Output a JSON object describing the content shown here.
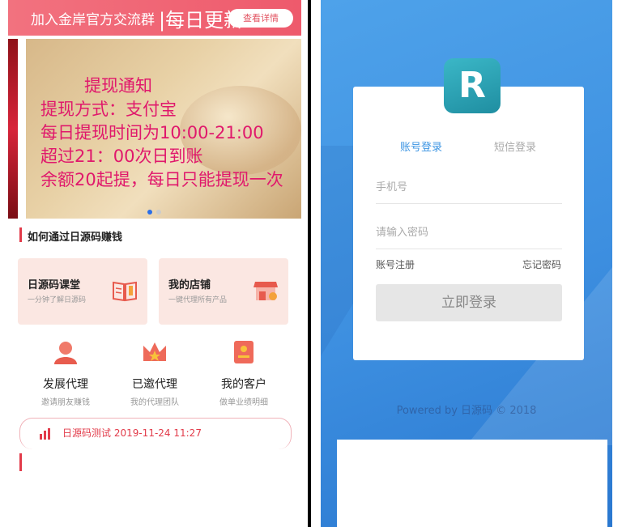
{
  "left": {
    "topbar": {
      "text": "加入金岸官方交流群",
      "big_text": "|每日更新",
      "button_label": "查看详情"
    },
    "banner": {
      "title": "提现通知",
      "lines": [
        "提现方式：支付宝",
        "每日提现时间为10:00-21:00",
        "超过21：00次日到账",
        "余额20起提，每日只能提现一次"
      ]
    },
    "section_title": "如何通过日源码赚钱",
    "cards": [
      {
        "title": "日源码课堂",
        "sub": "一分钟了解日源码",
        "icon": "book-icon"
      },
      {
        "title": "我的店铺",
        "sub": "一键代理所有产品",
        "icon": "shop-icon"
      }
    ],
    "actions": [
      {
        "label": "发展代理",
        "desc": "邀请朋友赚钱",
        "icon": "users-icon"
      },
      {
        "label": "已邀代理",
        "desc": "我的代理团队",
        "icon": "crown-icon"
      },
      {
        "label": "我的客户",
        "desc": "做单业绩明细",
        "icon": "client-card-icon"
      }
    ],
    "notice": "日源码测试 2019-11-24 11:27",
    "colors": {
      "accent": "#e23b4a",
      "topbar": "#ef6274"
    }
  },
  "right": {
    "logo_letter": "R",
    "tabs": [
      "账号登录",
      "短信登录"
    ],
    "fields": {
      "phone_placeholder": "手机号",
      "password_placeholder": "请输入密码"
    },
    "links": {
      "register": "账号注册",
      "forgot": "忘记密码"
    },
    "login_button": "立即登录",
    "footer": "Powered by 日源码 © 2018",
    "colors": {
      "background": "#3d8fe0",
      "active_tab": "#3d95e3",
      "logo": "#2aa1b4"
    }
  }
}
